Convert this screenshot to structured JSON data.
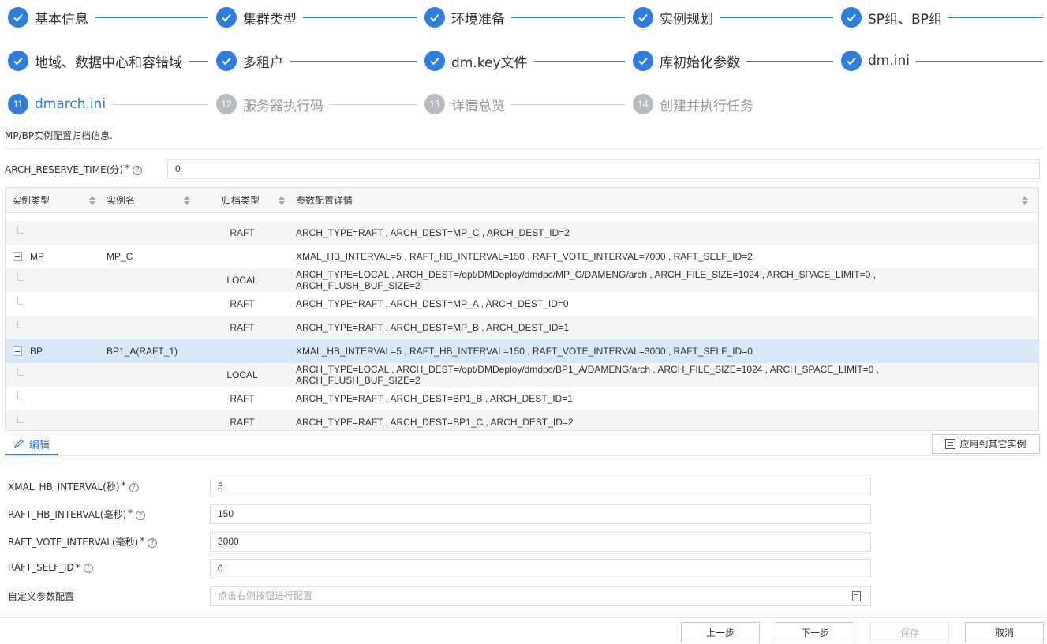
{
  "steps": [
    {
      "num": "1",
      "label": "基本信息",
      "state": "done"
    },
    {
      "num": "2",
      "label": "集群类型",
      "state": "done"
    },
    {
      "num": "3",
      "label": "环境准备",
      "state": "done"
    },
    {
      "num": "4",
      "label": "实例规划",
      "state": "done"
    },
    {
      "num": "5",
      "label": "SP组、BP组",
      "state": "done"
    },
    {
      "num": "6",
      "label": "地域、数据中心和容错域",
      "state": "done"
    },
    {
      "num": "7",
      "label": "多租户",
      "state": "done"
    },
    {
      "num": "8",
      "label": "dm.key文件",
      "state": "done"
    },
    {
      "num": "9",
      "label": "库初始化参数",
      "state": "done"
    },
    {
      "num": "10",
      "label": "dm.ini",
      "state": "done"
    },
    {
      "num": "11",
      "label": "dmarch.ini",
      "state": "active"
    },
    {
      "num": "12",
      "label": "服务器执行码",
      "state": "todo"
    },
    {
      "num": "13",
      "label": "详情总览",
      "state": "todo"
    },
    {
      "num": "14",
      "label": "创建并执行任务",
      "state": "todo"
    }
  ],
  "description": "MP/BP实例配置归档信息.",
  "arch_reserve": {
    "label": "ARCH_RESERVE_TIME(分)",
    "required": "*",
    "value": "0"
  },
  "table": {
    "columns": [
      "实例类型",
      "实例名",
      "归档类型",
      "参数配置详情"
    ],
    "rows": [
      {
        "kind": "child",
        "type": "",
        "name": "",
        "arch": "RAFT",
        "detail": "ARCH_TYPE=RAFT , ARCH_DEST=MP_C , ARCH_DEST_ID=2",
        "detail2": ""
      },
      {
        "kind": "parent",
        "type": "MP",
        "name": "MP_C",
        "arch": "",
        "detail": "XMAL_HB_INTERVAL=5 , RAFT_HB_INTERVAL=150 , RAFT_VOTE_INTERVAL=7000 , RAFT_SELF_ID=2",
        "detail2": ""
      },
      {
        "kind": "child",
        "type": "",
        "name": "",
        "arch": "LOCAL",
        "detail": "ARCH_TYPE=LOCAL , ARCH_DEST=/opt/DMDeploy/dmdpc/MP_C/DAMENG/arch , ARCH_FILE_SIZE=1024 , ARCH_SPACE_LIMIT=0 ,",
        "detail2": "ARCH_FLUSH_BUF_SIZE=2"
      },
      {
        "kind": "child",
        "type": "",
        "name": "",
        "arch": "RAFT",
        "detail": "ARCH_TYPE=RAFT , ARCH_DEST=MP_A , ARCH_DEST_ID=0",
        "detail2": ""
      },
      {
        "kind": "child",
        "type": "",
        "name": "",
        "arch": "RAFT",
        "detail": "ARCH_TYPE=RAFT , ARCH_DEST=MP_B , ARCH_DEST_ID=1",
        "detail2": ""
      },
      {
        "kind": "parent",
        "type": "BP",
        "name": "BP1_A(RAFT_1)",
        "arch": "",
        "detail": "XMAL_HB_INTERVAL=5 , RAFT_HB_INTERVAL=150 , RAFT_VOTE_INTERVAL=3000 , RAFT_SELF_ID=0",
        "detail2": ""
      },
      {
        "kind": "child",
        "type": "",
        "name": "",
        "arch": "LOCAL",
        "detail": "ARCH_TYPE=LOCAL , ARCH_DEST=/opt/DMDeploy/dmdpc/BP1_A/DAMENG/arch , ARCH_FILE_SIZE=1024 , ARCH_SPACE_LIMIT=0 ,",
        "detail2": "ARCH_FLUSH_BUF_SIZE=2"
      },
      {
        "kind": "child",
        "type": "",
        "name": "",
        "arch": "RAFT",
        "detail": "ARCH_TYPE=RAFT , ARCH_DEST=BP1_B , ARCH_DEST_ID=1",
        "detail2": ""
      },
      {
        "kind": "child",
        "type": "",
        "name": "",
        "arch": "RAFT",
        "detail": "ARCH_TYPE=RAFT , ARCH_DEST=BP1_C , ARCH_DEST_ID=2",
        "detail2": ""
      }
    ]
  },
  "edit_tab": "编辑",
  "apply_button": "应用到其它实例",
  "form": {
    "xmal": {
      "label": "XMAL_HB_INTERVAL(秒)",
      "required": "*",
      "value": "5"
    },
    "raft_hb": {
      "label": "RAFT_HB_INTERVAL(毫秒)",
      "required": "*",
      "value": "150"
    },
    "raft_vote": {
      "label": "RAFT_VOTE_INTERVAL(毫秒)",
      "required": "*",
      "value": "3000"
    },
    "raft_self": {
      "label": "RAFT_SELF_ID",
      "required": "*",
      "value": "0"
    },
    "custom": {
      "label": "自定义参数配置",
      "placeholder": "点击右侧按钮进行配置"
    }
  },
  "buttons": {
    "prev": "上一步",
    "next": "下一步",
    "save": "保存",
    "cancel": "取消"
  },
  "colors": {
    "accent": "#2f7de1",
    "selected_row": "#d9e8f9",
    "todo_step": "#b8bbc1"
  }
}
